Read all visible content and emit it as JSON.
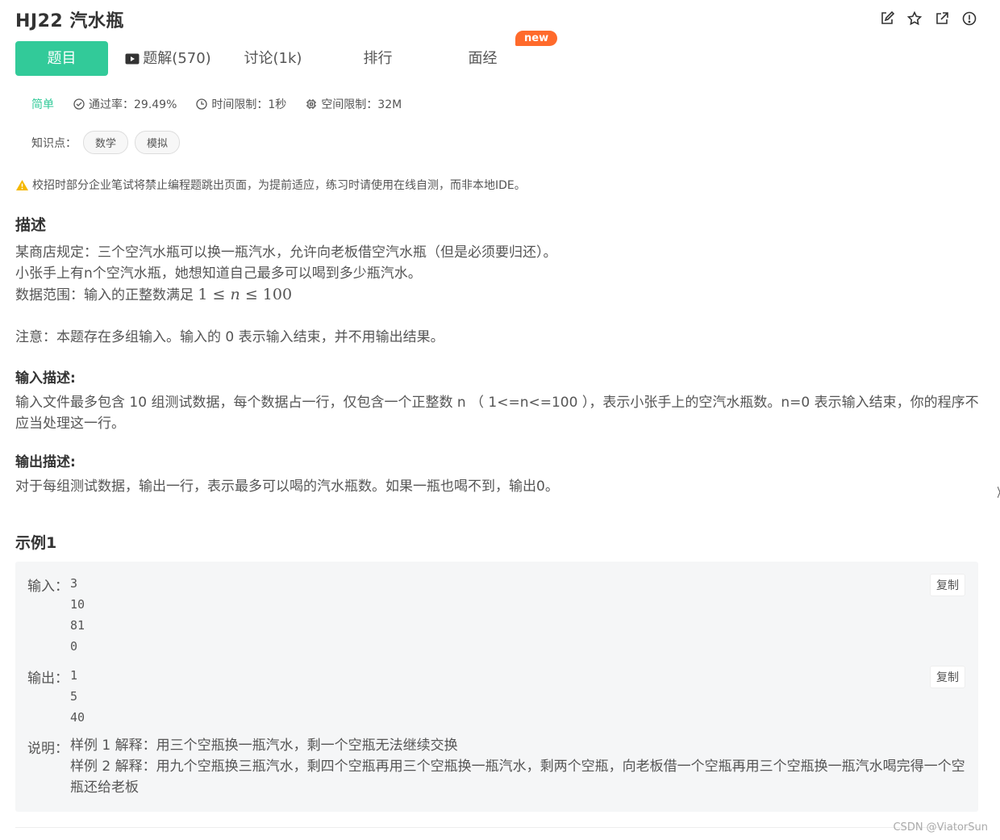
{
  "header": {
    "title": "HJ22  汽水瓶"
  },
  "tabs": [
    {
      "label": "题目"
    },
    {
      "label": "题解(570)"
    },
    {
      "label": "讨论(1k)"
    },
    {
      "label": "排行"
    },
    {
      "label": "面经"
    }
  ],
  "new_badge": "new",
  "meta": {
    "difficulty": "简单",
    "pass_rate": "通过率：29.49%",
    "time_limit": "时间限制：1秒",
    "space_limit": "空间限制：32M"
  },
  "knowledge": {
    "label": "知识点：",
    "tags": [
      "数学",
      "模拟"
    ]
  },
  "warning": "校招时部分企业笔试将禁止编程题跳出页面，为提前适应，练习时请使用在线自测，而非本地IDE。",
  "description": {
    "heading": "描述",
    "line1": "某商店规定：三个空汽水瓶可以换一瓶汽水，允许向老板借空汽水瓶（但是必须要归还）。",
    "line2": "小张手上有n个空汽水瓶，她想知道自己最多可以喝到多少瓶汽水。",
    "line3_prefix": "数据范围：输入的正整数满足 ",
    "math_lo": "1",
    "math_le": "≤",
    "math_var": "n",
    "math_hi": "100",
    "note": "注意：本题存在多组输入。输入的 0 表示输入结束，并不用输出结果。"
  },
  "input_desc": {
    "heading": "输入描述:",
    "text": "输入文件最多包含 10 组测试数据，每个数据占一行，仅包含一个正整数 n （ 1<=n<=100 ），表示小张手上的空汽水瓶数。n=0 表示输入结束，你的程序不应当处理这一行。"
  },
  "output_desc": {
    "heading": "输出描述:",
    "text": "对于每组测试数据，输出一行，表示最多可以喝的汽水瓶数。如果一瓶也喝不到，输出0。"
  },
  "example": {
    "heading": "示例1",
    "input_label": "输入：",
    "input_lines": [
      "3",
      "10",
      "81",
      "0"
    ],
    "output_label": "输出：",
    "output_lines": [
      "1",
      "5",
      "40"
    ],
    "copy_label": "复制",
    "explain_label": "说明：",
    "explain_line1": "样例 1 解释：用三个空瓶换一瓶汽水，剩一个空瓶无法继续交换",
    "explain_line2": "样例 2 解释：用九个空瓶换三瓶汽水，剩四个空瓶再用三个空瓶换一瓶汽水，剩两个空瓶，向老板借一个空瓶再用三个空瓶换一瓶汽水喝完得一个空瓶还给老板"
  },
  "watermark": "CSDN @ViatorSun",
  "colors": {
    "accent": "#32ca99",
    "badge": "#ff6a2b",
    "warning": "#f5b800"
  }
}
